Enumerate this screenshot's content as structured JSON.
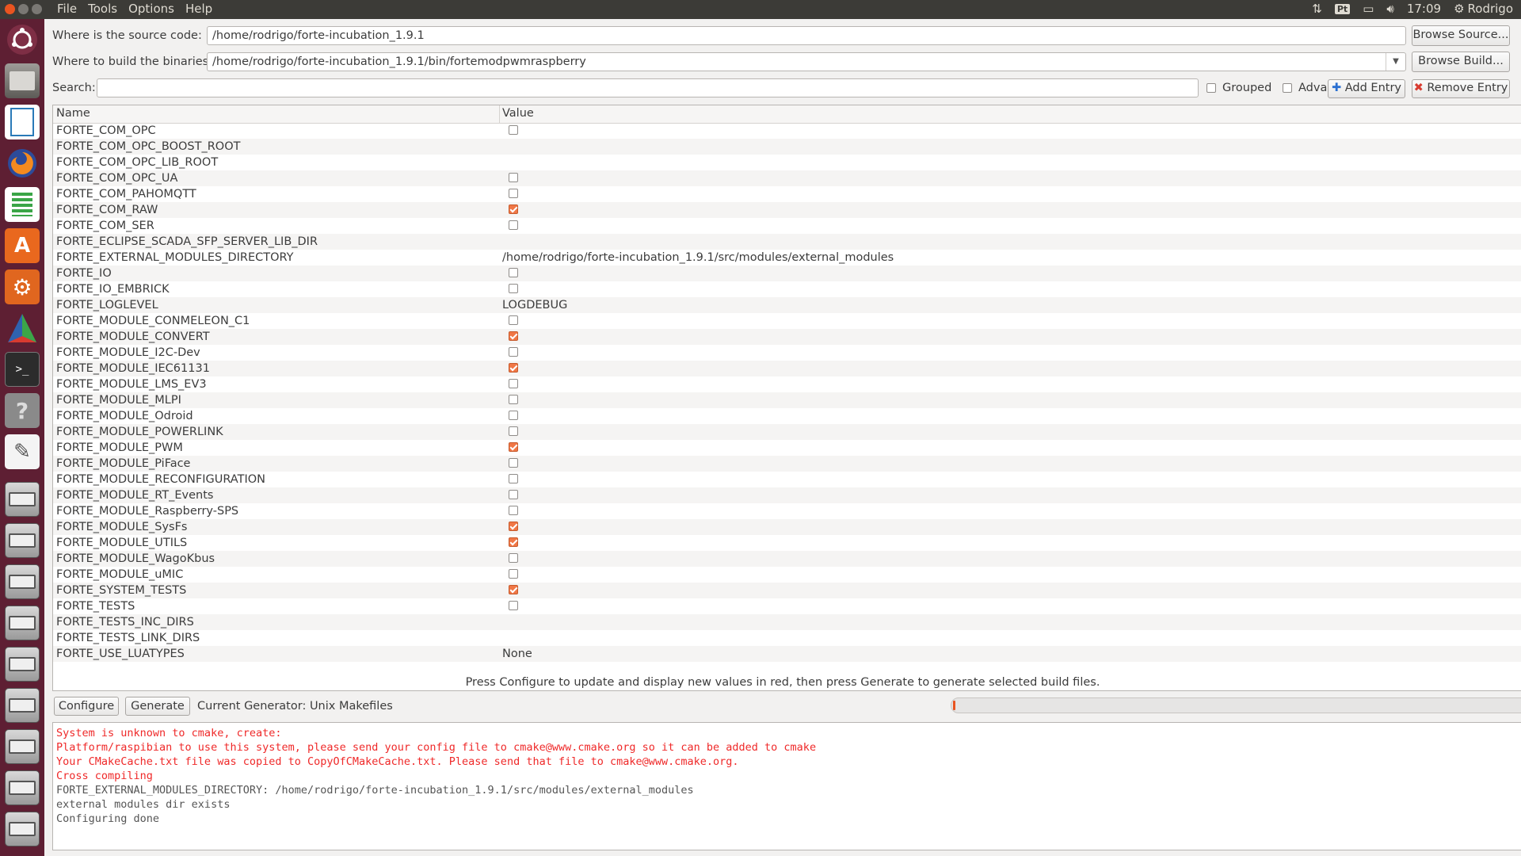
{
  "topbar": {
    "menu": [
      "File",
      "Tools",
      "Options",
      "Help"
    ],
    "keyboard": "Pt",
    "time": "17:09",
    "user": "Rodrigo"
  },
  "launcher": {
    "items": [
      "ubuntu-dash-icon",
      "files-icon",
      "writer-icon",
      "firefox-icon",
      "calc-icon",
      "software-center-icon",
      "system-settings-icon",
      "cmake-gui-icon",
      "terminal-icon",
      "help-icon",
      "text-editor-icon",
      "drive-icon",
      "drive-icon",
      "drive-icon",
      "drive-icon",
      "drive-icon",
      "drive-icon",
      "drive-icon",
      "drive-icon",
      "drive-icon",
      "trash-icon"
    ]
  },
  "source": {
    "label": "Where is the source code:",
    "value": "/home/rodrigo/forte-incubation_1.9.1",
    "browse": "Browse Source..."
  },
  "build": {
    "label": "Where to build the binaries:",
    "value": "/home/rodrigo/forte-incubation_1.9.1/bin/fortemodpwmraspberry",
    "browse": "Browse Build..."
  },
  "search": {
    "label": "Search:",
    "value": "",
    "grouped": "Grouped",
    "advanced": "Advanced",
    "add_entry": "Add Entry",
    "remove_entry": "Remove Entry"
  },
  "table": {
    "headers": [
      "Name",
      "Value"
    ],
    "rows": [
      {
        "name": "FORTE_COM_OPC",
        "type": "bool",
        "checked": false
      },
      {
        "name": "FORTE_COM_OPC_BOOST_ROOT",
        "type": "text",
        "value": ""
      },
      {
        "name": "FORTE_COM_OPC_LIB_ROOT",
        "type": "text",
        "value": ""
      },
      {
        "name": "FORTE_COM_OPC_UA",
        "type": "bool",
        "checked": false
      },
      {
        "name": "FORTE_COM_PAHOMQTT",
        "type": "bool",
        "checked": false
      },
      {
        "name": "FORTE_COM_RAW",
        "type": "bool",
        "checked": true
      },
      {
        "name": "FORTE_COM_SER",
        "type": "bool",
        "checked": false
      },
      {
        "name": "FORTE_ECLIPSE_SCADA_SFP_SERVER_LIB_DIR",
        "type": "text",
        "value": ""
      },
      {
        "name": "FORTE_EXTERNAL_MODULES_DIRECTORY",
        "type": "text",
        "value": "/home/rodrigo/forte-incubation_1.9.1/src/modules/external_modules"
      },
      {
        "name": "FORTE_IO",
        "type": "bool",
        "checked": false
      },
      {
        "name": "FORTE_IO_EMBRICK",
        "type": "bool",
        "checked": false
      },
      {
        "name": "FORTE_LOGLEVEL",
        "type": "text",
        "value": "LOGDEBUG"
      },
      {
        "name": "FORTE_MODULE_CONMELEON_C1",
        "type": "bool",
        "checked": false
      },
      {
        "name": "FORTE_MODULE_CONVERT",
        "type": "bool",
        "checked": true
      },
      {
        "name": "FORTE_MODULE_I2C-Dev",
        "type": "bool",
        "checked": false
      },
      {
        "name": "FORTE_MODULE_IEC61131",
        "type": "bool",
        "checked": true
      },
      {
        "name": "FORTE_MODULE_LMS_EV3",
        "type": "bool",
        "checked": false
      },
      {
        "name": "FORTE_MODULE_MLPI",
        "type": "bool",
        "checked": false
      },
      {
        "name": "FORTE_MODULE_Odroid",
        "type": "bool",
        "checked": false
      },
      {
        "name": "FORTE_MODULE_POWERLINK",
        "type": "bool",
        "checked": false
      },
      {
        "name": "FORTE_MODULE_PWM",
        "type": "bool",
        "checked": true
      },
      {
        "name": "FORTE_MODULE_PiFace",
        "type": "bool",
        "checked": false
      },
      {
        "name": "FORTE_MODULE_RECONFIGURATION",
        "type": "bool",
        "checked": false
      },
      {
        "name": "FORTE_MODULE_RT_Events",
        "type": "bool",
        "checked": false
      },
      {
        "name": "FORTE_MODULE_Raspberry-SPS",
        "type": "bool",
        "checked": false
      },
      {
        "name": "FORTE_MODULE_SysFs",
        "type": "bool",
        "checked": true
      },
      {
        "name": "FORTE_MODULE_UTILS",
        "type": "bool",
        "checked": true
      },
      {
        "name": "FORTE_MODULE_WagoKbus",
        "type": "bool",
        "checked": false
      },
      {
        "name": "FORTE_MODULE_uMIC",
        "type": "bool",
        "checked": false
      },
      {
        "name": "FORTE_SYSTEM_TESTS",
        "type": "bool",
        "checked": true
      },
      {
        "name": "FORTE_TESTS",
        "type": "bool",
        "checked": false
      },
      {
        "name": "FORTE_TESTS_INC_DIRS",
        "type": "text",
        "value": ""
      },
      {
        "name": "FORTE_TESTS_LINK_DIRS",
        "type": "text",
        "value": ""
      },
      {
        "name": "FORTE_USE_LUATYPES",
        "type": "text",
        "value": "None"
      }
    ]
  },
  "hint": "Press Configure to update and display new values in red, then press Generate to generate selected build files.",
  "actions": {
    "configure": "Configure",
    "generate": "Generate",
    "generator": "Current Generator: Unix Makefiles"
  },
  "progress": 0.004,
  "output": [
    {
      "text": "System is unknown to cmake, create:",
      "color": "#ef2929"
    },
    {
      "text": "Platform/raspibian to use this system, please send your config file to cmake@www.cmake.org so it can be added to cmake",
      "color": "#ef2929"
    },
    {
      "text": "Your CMakeCache.txt file was copied to CopyOfCMakeCache.txt. Please send that file to cmake@www.cmake.org.",
      "color": "#ef2929"
    },
    {
      "text": "Cross compiling",
      "color": "#ef2929"
    },
    {
      "text": "FORTE_EXTERNAL_MODULES_DIRECTORY: /home/rodrigo/forte-incubation_1.9.1/src/modules/external_modules",
      "color": "#555555"
    },
    {
      "text": "external modules dir exists",
      "color": "#555555"
    },
    {
      "text": "Configuring done",
      "color": "#555555"
    }
  ],
  "colors": {
    "accent": "#e95420",
    "launcher_bg": "#5e1f33",
    "panel_bg": "#3c3b37",
    "error_text": "#ef2929"
  }
}
